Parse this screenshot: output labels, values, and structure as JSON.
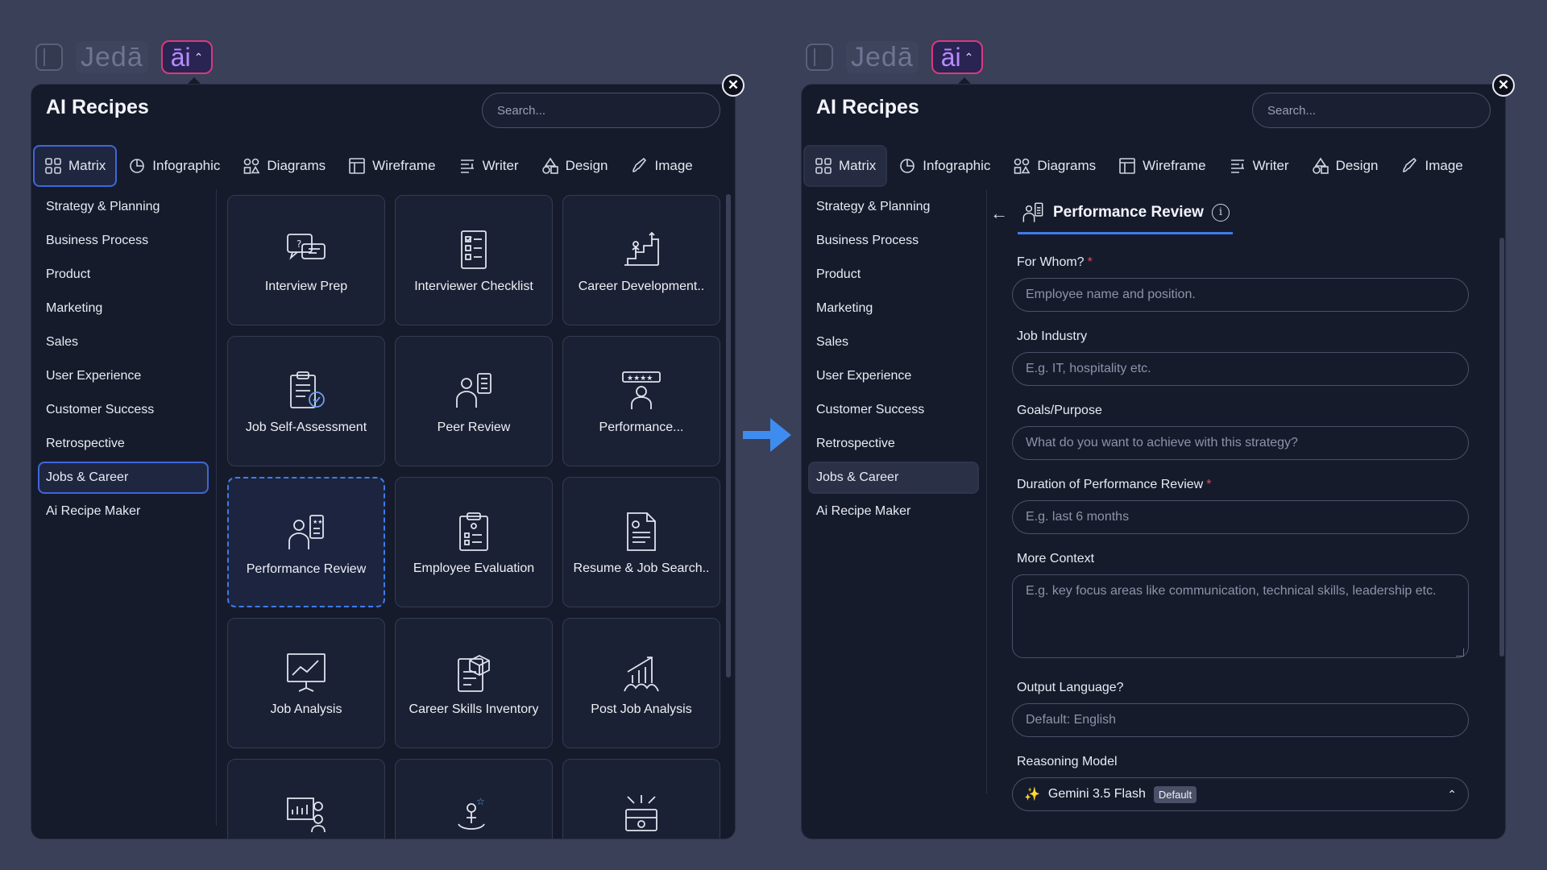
{
  "topbar": {
    "brand": "Jedā",
    "ai_label": "āi",
    "caret": "^"
  },
  "panel": {
    "title": "AI Recipes",
    "search_placeholder": "Search...",
    "close": "✕",
    "tabs": [
      {
        "label": "Matrix",
        "icon": "grid-icon"
      },
      {
        "label": "Infographic",
        "icon": "pie-chart-icon"
      },
      {
        "label": "Diagrams",
        "icon": "diagram-icon"
      },
      {
        "label": "Wireframe",
        "icon": "wireframe-icon"
      },
      {
        "label": "Writer",
        "icon": "writer-icon"
      },
      {
        "label": "Design",
        "icon": "shapes-icon"
      },
      {
        "label": "Image",
        "icon": "image-brush-icon"
      }
    ],
    "categories": [
      "Strategy & Planning",
      "Business Process",
      "Product",
      "Marketing",
      "Sales",
      "User Experience",
      "Customer Success",
      "Retrospective",
      "Jobs & Career",
      "Ai Recipe Maker"
    ],
    "selected_category": "Jobs & Career"
  },
  "recipes": [
    {
      "label": "Interview Prep",
      "icon": "chat-bubbles-icon"
    },
    {
      "label": "Interviewer Checklist",
      "icon": "checklist-icon"
    },
    {
      "label": "Career Development..",
      "icon": "career-stairs-icon"
    },
    {
      "label": "Job Self-Assessment",
      "icon": "clipboard-check-icon"
    },
    {
      "label": "Peer Review",
      "icon": "peer-review-icon"
    },
    {
      "label": "Performance...",
      "icon": "rating-person-icon"
    },
    {
      "label": "Performance Review",
      "icon": "performance-review-icon"
    },
    {
      "label": "Employee Evaluation",
      "icon": "evaluation-clipboard-icon"
    },
    {
      "label": "Resume & Job Search..",
      "icon": "resume-icon"
    },
    {
      "label": "Job Analysis",
      "icon": "presentation-chart-icon"
    },
    {
      "label": "Career Skills Inventory",
      "icon": "skills-box-icon"
    },
    {
      "label": "Post Job Analysis",
      "icon": "growth-chart-icon"
    },
    {
      "label": "",
      "icon": "team-chart-icon"
    },
    {
      "label": "",
      "icon": "person-star-icon"
    },
    {
      "label": "",
      "icon": "toolbox-icon"
    }
  ],
  "form": {
    "title": "Performance Review",
    "fields": [
      {
        "label": "For Whom?",
        "required": true,
        "placeholder": "Employee name and position."
      },
      {
        "label": "Job Industry",
        "required": false,
        "placeholder": "E.g. IT, hospitality etc."
      },
      {
        "label": "Goals/Purpose",
        "required": false,
        "placeholder": "What do you want to achieve with this strategy?"
      },
      {
        "label": "Duration of Performance Review",
        "required": true,
        "placeholder": "E.g. last 6 months"
      },
      {
        "label": "More Context",
        "required": false,
        "placeholder": "E.g. key focus areas like communication, technical skills, leadership etc."
      },
      {
        "label": "Output Language?",
        "required": false,
        "placeholder": "Default: English"
      }
    ],
    "model": {
      "label": "Reasoning Model",
      "name": "Gemini 3.5 Flash",
      "badge": "Default"
    },
    "required_mark": "*"
  },
  "colors": {
    "accent": "#3f66d8",
    "ai_border": "#d93a7c",
    "panel_bg": "#161b2c",
    "arrow": "#3f8cf0"
  }
}
